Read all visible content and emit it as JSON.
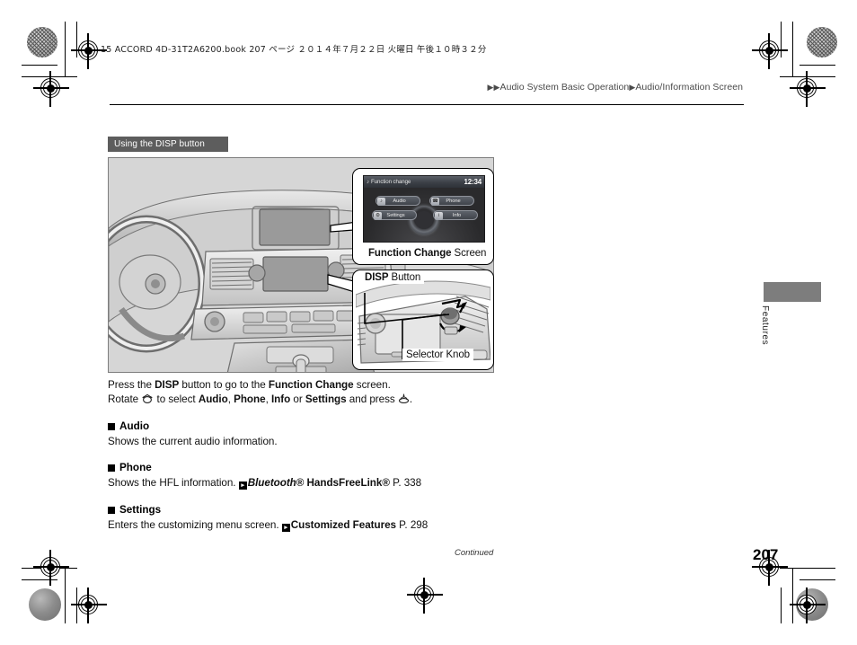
{
  "print_marks": {
    "book_line": "15 ACCORD 4D-31T2A6200.book   207 ページ   ２０１４年７月２２日   火曜日   午後１０時３２分"
  },
  "header": {
    "breadcrumb": [
      {
        "label": "Audio System Basic Operation"
      },
      {
        "label": "Audio/Information Screen"
      }
    ],
    "arrow_glyph": "▶"
  },
  "section": {
    "tag": "Using the DISP button"
  },
  "illustration": {
    "callouts": [
      {
        "id": "function-change",
        "caption_bold": "Function Change",
        "caption_rest": " Screen"
      },
      {
        "id": "disp-button",
        "caption_bold": "DISP",
        "caption_rest": " Button"
      },
      {
        "id": "selector-knob",
        "caption": "Selector Knob"
      }
    ],
    "nav_screen": {
      "title": "Function change",
      "title_icon": "music-note-icon",
      "clock": "12:34",
      "buttons": [
        {
          "label": "Audio",
          "icon": "music-note-icon"
        },
        {
          "label": "Phone",
          "icon": "phone-icon"
        },
        {
          "label": "Settings",
          "icon": "gear-icon"
        },
        {
          "label": "Info",
          "icon": "info-icon"
        }
      ],
      "knob": "selector-knob"
    }
  },
  "body": {
    "intro": {
      "line1_a": "Press the ",
      "line1_b": "DISP",
      "line1_c": " button to go to the ",
      "line1_d": "Function Change",
      "line1_e": " screen.",
      "line2_a": "Rotate ",
      "line2_rotate_icon": "rotate-knob-icon",
      "line2_b": " to select ",
      "line2_c": "Audio",
      "line2_d": ", ",
      "line2_e": "Phone",
      "line2_f": ", ",
      "line2_g": "Info",
      "line2_h": " or ",
      "line2_i": "Settings",
      "line2_j": " and press ",
      "line2_press_icon": "press-knob-icon",
      "line2_k": "."
    },
    "sections": [
      {
        "heading": "Audio",
        "text": "Shows the current audio information."
      },
      {
        "heading": "Phone",
        "text": "Shows the HFL information. ",
        "ref_italic": "Bluetooth",
        "ref_sup1": "®",
        "ref_bold": " HandsFreeLink",
        "ref_sup2": "®",
        "ref_page": " P. 338"
      },
      {
        "heading": "Settings",
        "text": "Enters the customizing menu screen. ",
        "ref_bold": "Customized Features",
        "ref_page": " P. 298"
      }
    ]
  },
  "side_tab": {
    "label": "Features"
  },
  "footer": {
    "continued": "Continued",
    "page_number": "207"
  },
  "colors": {
    "tag_background": "#5d5d5d",
    "illustration_background": "#d6d6d6",
    "screen_background": "#2a2a2c",
    "side_tab": "#7d7d7d"
  }
}
